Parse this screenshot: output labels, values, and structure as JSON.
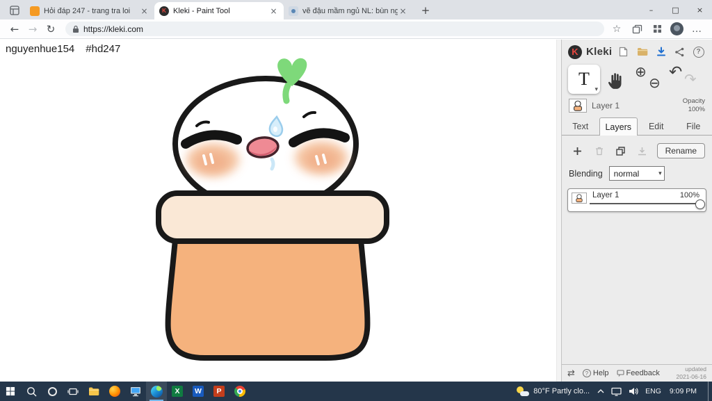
{
  "browser": {
    "tabs": [
      {
        "title": "Hỏi đáp 247 - trang tra loi"
      },
      {
        "title": "Kleki - Paint Tool"
      },
      {
        "title": "vẽ đậu mầm ngủ NL: bùn ngủ :)"
      }
    ],
    "url": "https://kleki.com"
  },
  "canvas": {
    "username": "nguyenhue154",
    "tag": "#hd247"
  },
  "kleki": {
    "brand": "Kleki",
    "brand_initial": "K",
    "text_tool_label": "T",
    "layer_preview": {
      "name": "Layer 1",
      "opacity_label": "Opacity",
      "opacity_value": "100%"
    },
    "tabs": [
      {
        "label": "Text"
      },
      {
        "label": "Layers"
      },
      {
        "label": "Edit"
      },
      {
        "label": "File"
      }
    ],
    "rename_button": "Rename",
    "blending_label": "Blending",
    "blending_value": "normal",
    "layer": {
      "name": "Layer 1",
      "opacity": "100%"
    },
    "footer": {
      "help": "Help",
      "feedback": "Feedback",
      "updated_label": "updated",
      "updated_date": "2021-06-16"
    }
  },
  "taskbar": {
    "weather": "80°F Partly clo...",
    "language": "ENG",
    "time": "9:09 PM"
  },
  "icons": {
    "close": "×",
    "minimize": "–",
    "maximize": "□",
    "new_tab": "+",
    "back": "←",
    "forward": "→",
    "refresh": "↻",
    "star": "☆",
    "more": "…",
    "dropdown": "▾",
    "zoom_in": "⊕",
    "zoom_out": "⊖",
    "undo": "↶",
    "redo": "↷",
    "history": "⇄",
    "help": "?",
    "excel": "X",
    "word": "W",
    "ppt": "P"
  },
  "colors": {
    "taskbar_bg": "#24364a",
    "accent_blue": "#76b9ed",
    "download_arrow": "#1f6fd0",
    "sprout_green": "#7ed97a",
    "body_orange": "#f5b27d",
    "rim_peach": "#fae8d6",
    "tongue_pink": "#ef8a94",
    "kleki_logo_red": "#e8473f"
  }
}
